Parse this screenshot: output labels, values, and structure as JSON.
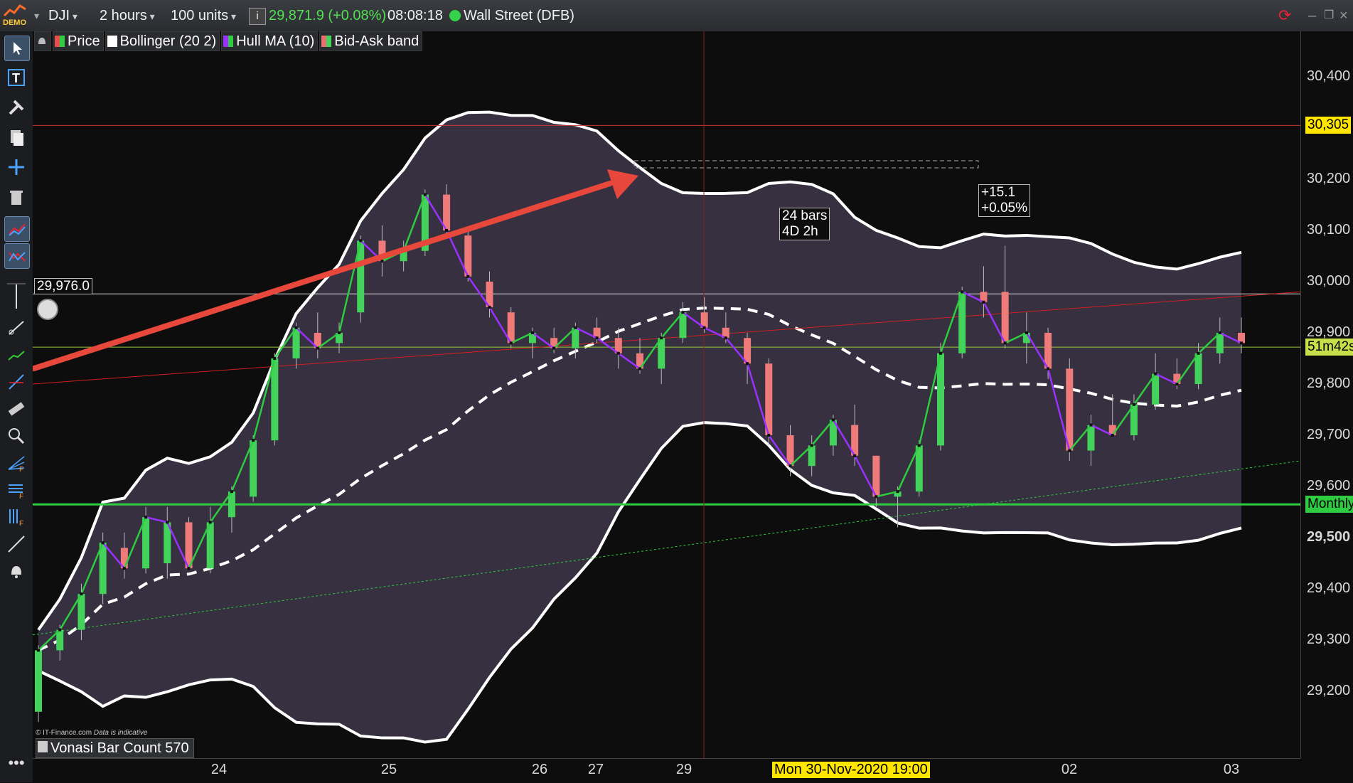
{
  "topbar": {
    "demo_label": "DEMO",
    "symbol": "DJI",
    "timeframe": "2 hours",
    "units": "100 units",
    "price": "29,871.9 (+0.08%)",
    "time": "08:08:18",
    "instrument": "Wall Street (DFB)"
  },
  "legend": [
    {
      "label": "Price",
      "color": "#e84e4e",
      "color2": "#2ecc40"
    },
    {
      "label": "Bollinger (20 2)",
      "color": "#ffffff"
    },
    {
      "label": "Hull MA (10)",
      "color": "#9b30ff"
    },
    {
      "label": "Bid-Ask band",
      "color": "#e87070"
    }
  ],
  "chart_data": {
    "type": "candlestick",
    "title": "DJI",
    "yticks": [
      30400,
      30200,
      30100,
      30000,
      29900,
      29800,
      29700,
      29600,
      29500,
      29400,
      29300,
      29200
    ],
    "ylabels": [
      "30,400",
      "30,200",
      "30,100",
      "30,000",
      "29,900",
      "29,800",
      "29,700",
      "29,600",
      "29,500",
      "29,400",
      "29,300",
      "29,200"
    ],
    "xlabels": [
      "24",
      "25",
      "26",
      "27",
      "29",
      "02",
      "03"
    ],
    "price_tags": {
      "upper": "30,305",
      "countdown": "51m42s",
      "support": "Monthly",
      "bold_level": "29,500",
      "horizontal_line": "29,976.0"
    },
    "levels": {
      "upper_red": 30305,
      "white_line": 29976,
      "support_green": 29565,
      "last_price": 29872
    },
    "candles": [
      {
        "o": 29160,
        "h": 29290,
        "l": 29140,
        "c": 29280
      },
      {
        "o": 29280,
        "h": 29330,
        "l": 29260,
        "c": 29320
      },
      {
        "o": 29320,
        "h": 29410,
        "l": 29300,
        "c": 29390
      },
      {
        "o": 29390,
        "h": 29510,
        "l": 29370,
        "c": 29490
      },
      {
        "o": 29480,
        "h": 29510,
        "l": 29420,
        "c": 29440
      },
      {
        "o": 29440,
        "h": 29560,
        "l": 29430,
        "c": 29540
      },
      {
        "o": 29450,
        "h": 29560,
        "l": 29420,
        "c": 29530
      },
      {
        "o": 29530,
        "h": 29540,
        "l": 29440,
        "c": 29440
      },
      {
        "o": 29440,
        "h": 29560,
        "l": 29430,
        "c": 29530
      },
      {
        "o": 29540,
        "h": 29600,
        "l": 29510,
        "c": 29590
      },
      {
        "o": 29580,
        "h": 29700,
        "l": 29570,
        "c": 29690
      },
      {
        "o": 29690,
        "h": 29860,
        "l": 29680,
        "c": 29850
      },
      {
        "o": 29850,
        "h": 29920,
        "l": 29830,
        "c": 29910
      },
      {
        "o": 29900,
        "h": 29940,
        "l": 29850,
        "c": 29870
      },
      {
        "o": 29880,
        "h": 29920,
        "l": 29860,
        "c": 29900
      },
      {
        "o": 29940,
        "h": 30090,
        "l": 29920,
        "c": 30080
      },
      {
        "o": 30080,
        "h": 30110,
        "l": 30010,
        "c": 30040
      },
      {
        "o": 30040,
        "h": 30080,
        "l": 30020,
        "c": 30060
      },
      {
        "o": 30060,
        "h": 30180,
        "l": 30050,
        "c": 30170
      },
      {
        "o": 30170,
        "h": 30190,
        "l": 30090,
        "c": 30100
      },
      {
        "o": 30090,
        "h": 30100,
        "l": 30000,
        "c": 30010
      },
      {
        "o": 30000,
        "h": 30020,
        "l": 29930,
        "c": 29950
      },
      {
        "o": 29940,
        "h": 29950,
        "l": 29870,
        "c": 29880
      },
      {
        "o": 29880,
        "h": 29910,
        "l": 29850,
        "c": 29900
      },
      {
        "o": 29890,
        "h": 29910,
        "l": 29860,
        "c": 29870
      },
      {
        "o": 29870,
        "h": 29920,
        "l": 29850,
        "c": 29910
      },
      {
        "o": 29910,
        "h": 29930,
        "l": 29880,
        "c": 29890
      },
      {
        "o": 29890,
        "h": 29910,
        "l": 29830,
        "c": 29860
      },
      {
        "o": 29860,
        "h": 29890,
        "l": 29820,
        "c": 29830
      },
      {
        "o": 29830,
        "h": 29900,
        "l": 29800,
        "c": 29890
      },
      {
        "o": 29890,
        "h": 29960,
        "l": 29880,
        "c": 29940
      },
      {
        "o": 29940,
        "h": 29970,
        "l": 29900,
        "c": 29910
      },
      {
        "o": 29910,
        "h": 29940,
        "l": 29880,
        "c": 29890
      },
      {
        "o": 29890,
        "h": 29900,
        "l": 29800,
        "c": 29840
      },
      {
        "o": 29840,
        "h": 29850,
        "l": 29680,
        "c": 29700
      },
      {
        "o": 29700,
        "h": 29720,
        "l": 29620,
        "c": 29640
      },
      {
        "o": 29640,
        "h": 29700,
        "l": 29620,
        "c": 29680
      },
      {
        "o": 29680,
        "h": 29740,
        "l": 29660,
        "c": 29730
      },
      {
        "o": 29720,
        "h": 29760,
        "l": 29640,
        "c": 29660
      },
      {
        "o": 29660,
        "h": 29660,
        "l": 29560,
        "c": 29580
      },
      {
        "o": 29580,
        "h": 29600,
        "l": 29520,
        "c": 29590
      },
      {
        "o": 29590,
        "h": 29690,
        "l": 29580,
        "c": 29680
      },
      {
        "o": 29680,
        "h": 29880,
        "l": 29670,
        "c": 29860
      },
      {
        "o": 29860,
        "h": 29990,
        "l": 29850,
        "c": 29980
      },
      {
        "o": 29980,
        "h": 30030,
        "l": 29930,
        "c": 29960
      },
      {
        "o": 29980,
        "h": 30070,
        "l": 29870,
        "c": 29880
      },
      {
        "o": 29880,
        "h": 29940,
        "l": 29840,
        "c": 29900
      },
      {
        "o": 29900,
        "h": 29910,
        "l": 29810,
        "c": 29830
      },
      {
        "o": 29830,
        "h": 29850,
        "l": 29650,
        "c": 29670
      },
      {
        "o": 29670,
        "h": 29740,
        "l": 29640,
        "c": 29720
      },
      {
        "o": 29720,
        "h": 29780,
        "l": 29700,
        "c": 29700
      },
      {
        "o": 29700,
        "h": 29780,
        "l": 29690,
        "c": 29760
      },
      {
        "o": 29760,
        "h": 29860,
        "l": 29750,
        "c": 29820
      },
      {
        "o": 29820,
        "h": 29850,
        "l": 29790,
        "c": 29800
      },
      {
        "o": 29800,
        "h": 29880,
        "l": 29790,
        "c": 29860
      },
      {
        "o": 29860,
        "h": 29930,
        "l": 29840,
        "c": 29900
      },
      {
        "o": 29900,
        "h": 29930,
        "l": 29860,
        "c": 29880
      }
    ],
    "annotations": {
      "measure_bars": "24 bars",
      "measure_time": "4D 2h",
      "measure_points": "+15.1",
      "measure_pct": "+0.05%",
      "cursor_date": "Mon 30-Nov-2020 19:00"
    }
  },
  "footer": {
    "credit": "© IT-Finance.com",
    "credit_note": "Data is indicative",
    "indicator_label": "Vonasi Bar Count 570"
  },
  "colors": {
    "bull": "#44d35a",
    "bear": "#ef7a7a",
    "band_fill": "#3b3446",
    "hull_up": "#2ecc40",
    "hull_down": "#9b30ff",
    "trend_arrow": "#e8483c"
  }
}
